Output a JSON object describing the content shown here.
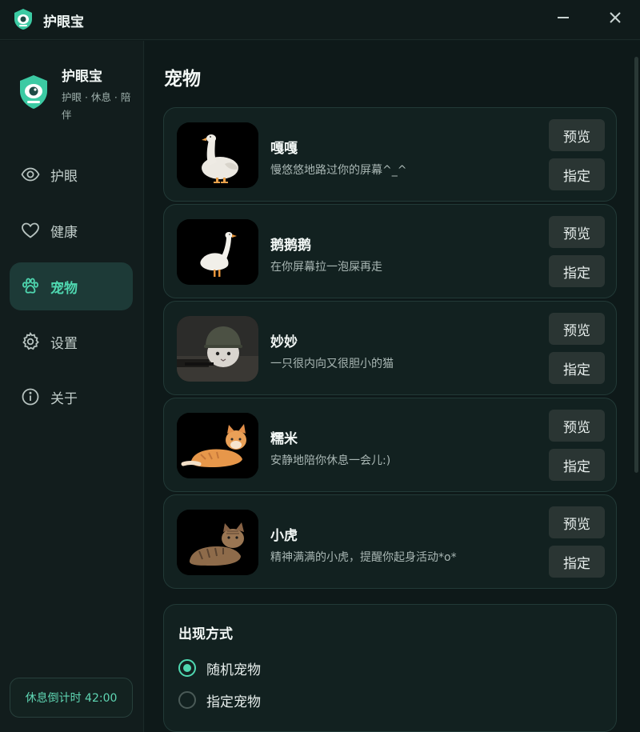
{
  "app": {
    "title": "护眼宝"
  },
  "window": {
    "minimize_icon": "minus-icon",
    "close_icon": "close-icon"
  },
  "sidebar": {
    "brand_name": "护眼宝",
    "brand_tagline": "护眼 · 休息 · 陪伴",
    "items": [
      {
        "label": "护眼",
        "icon": "eye-icon",
        "active": false
      },
      {
        "label": "健康",
        "icon": "heart-icon",
        "active": false
      },
      {
        "label": "宠物",
        "icon": "paw-icon",
        "active": true
      },
      {
        "label": "设置",
        "icon": "gear-icon",
        "active": false
      },
      {
        "label": "关于",
        "icon": "info-icon",
        "active": false
      }
    ],
    "countdown": "休息倒计时 42:00"
  },
  "main": {
    "title": "宠物",
    "pets": [
      {
        "name": "嘎嘎",
        "desc": "慢悠悠地路过你的屏幕^_^",
        "thumb": "goose-waddling",
        "preview_label": "预览",
        "assign_label": "指定"
      },
      {
        "name": "鹅鹅鹅",
        "desc": "在你屏幕拉一泡屎再走",
        "thumb": "white-goose",
        "preview_label": "预览",
        "assign_label": "指定"
      },
      {
        "name": "妙妙",
        "desc": "一只很内向又很胆小的猫",
        "thumb": "cat-in-helmet",
        "preview_label": "预览",
        "assign_label": "指定"
      },
      {
        "name": "糯米",
        "desc": "安静地陪你休息一会儿:)",
        "thumb": "orange-cat-lying",
        "preview_label": "预览",
        "assign_label": "指定"
      },
      {
        "name": "小虎",
        "desc": "精神满满的小虎，提醒你起身活动*o*",
        "thumb": "tabby-cat-lying",
        "preview_label": "预览",
        "assign_label": "指定"
      }
    ],
    "appearance": {
      "title": "出现方式",
      "options": [
        {
          "label": "随机宠物",
          "checked": true
        },
        {
          "label": "指定宠物",
          "checked": false
        }
      ]
    }
  },
  "colors": {
    "accent": "#4fd7b0",
    "background": "#0f1a1a",
    "card": "#122120"
  }
}
